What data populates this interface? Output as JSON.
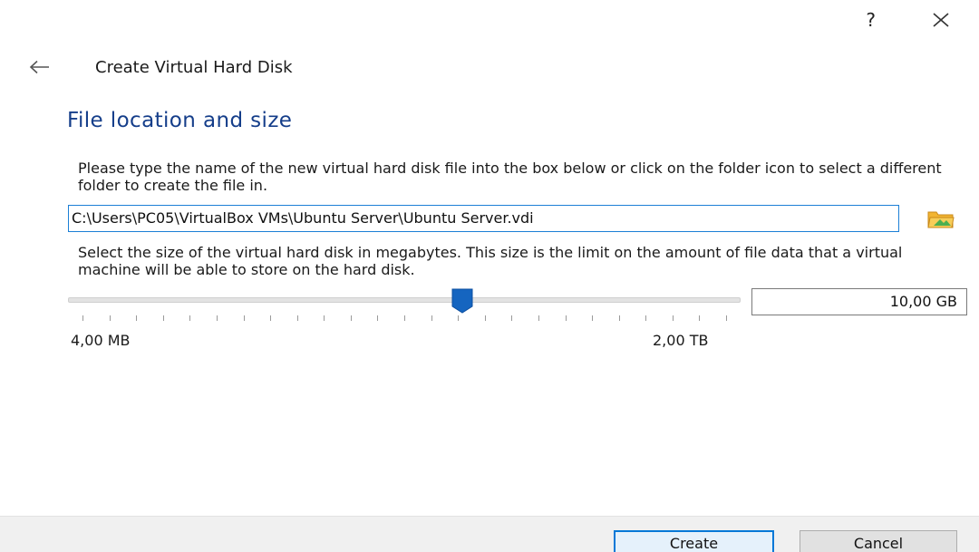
{
  "window": {
    "help_label": "?",
    "close_icon": "close-icon",
    "back_icon": "back-arrow-icon"
  },
  "wizard": {
    "title": "Create Virtual Hard Disk",
    "page_heading": "File location and size"
  },
  "file_location": {
    "description": "Please type the name of the new virtual hard disk file into the box below or click on the folder icon to select a different folder to create the file in.",
    "path_value": "C:\\Users\\PC05\\VirtualBox VMs\\Ubuntu Server\\Ubuntu Server.vdi",
    "folder_icon": "folder-icon"
  },
  "file_size": {
    "description": "Select the size of the virtual hard disk in megabytes. This size is the limit on the amount of file data that a virtual machine will be able to store on the hard disk.",
    "size_value": "10,00 GB",
    "slider_position_fraction": 0.586,
    "tick_count": 25,
    "range_min_label": "4,00 MB",
    "range_max_label": "2,00 TB"
  },
  "buttons": {
    "create_label": "Create",
    "cancel_label": "Cancel"
  },
  "colors": {
    "heading": "#153e8a",
    "accent": "#0078d7",
    "slider_thumb": "#1565c0"
  }
}
